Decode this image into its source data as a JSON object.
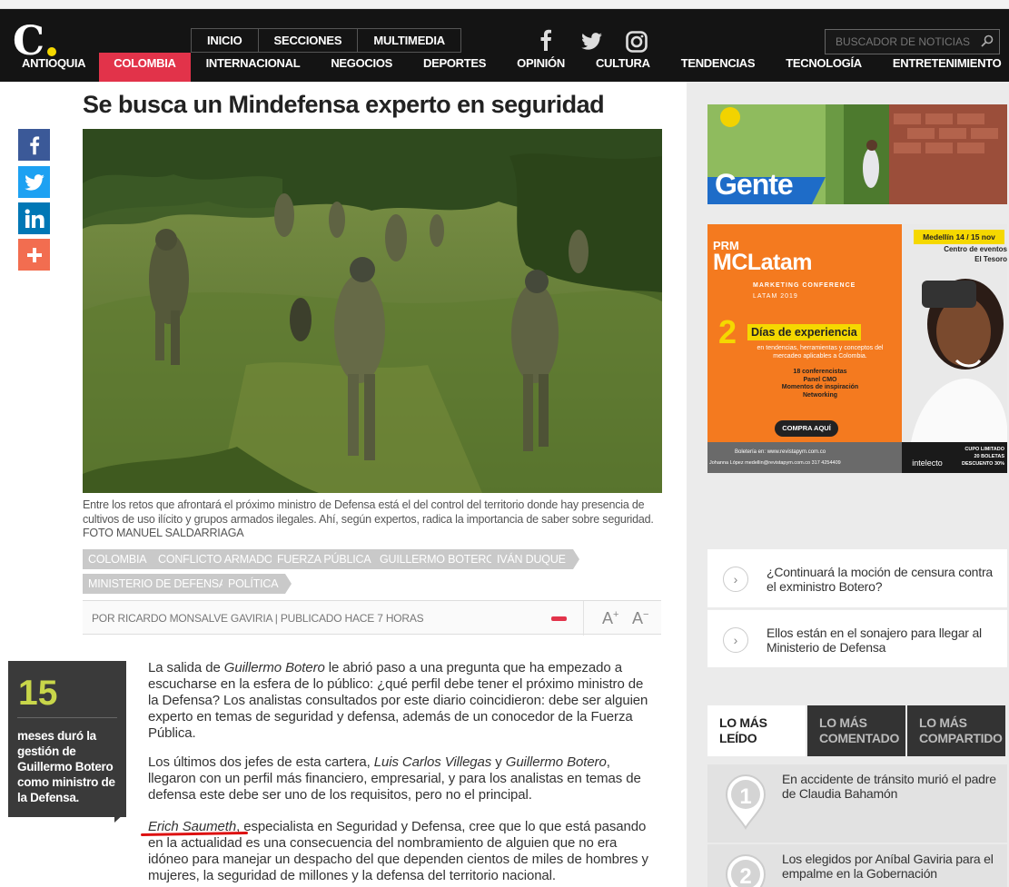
{
  "header": {
    "logo_letter": "C",
    "top_nav": [
      "INICIO",
      "SECCIONES",
      "MULTIMEDIA"
    ],
    "social_icons": [
      "facebook-icon",
      "twitter-icon",
      "instagram-icon"
    ],
    "search_placeholder": "BUSCADOR DE NOTICIAS",
    "sections": [
      "ANTIOQUIA",
      "COLOMBIA",
      "INTERNACIONAL",
      "NEGOCIOS",
      "DEPORTES",
      "OPINIÓN",
      "CULTURA",
      "TENDENCIAS",
      "TECNOLOGÍA",
      "ENTRETENIMIENTO"
    ],
    "active_section": "COLOMBIA",
    "accent_color": "#e2334a"
  },
  "share": {
    "icons": [
      "facebook-icon",
      "twitter-icon",
      "linkedin-icon",
      "plus-icon"
    ],
    "colors": [
      "#3b5998",
      "#1da1f2",
      "#0077b5",
      "#f26d50"
    ]
  },
  "article": {
    "title": "Se busca un Mindefensa experto en seguridad",
    "caption": "Entre los retos que afrontará el próximo ministro de Defensa está el del control del territorio donde hay presencia de cultivos de uso ilícito y grupos armados ilegales. Ahí, según expertos, radica la importancia de saber sobre seguridad. FOTO MANUEL SALDARRIAGA",
    "tags": [
      "COLOMBIA",
      "CONFLICTO ARMADO",
      "FUERZA PÚBLICA",
      "GUILLERMO BOTERO",
      "IVÁN DUQUE",
      "MINISTERIO DE DEFENSA",
      "POLÍTICA"
    ],
    "byline": "POR RICARDO MONSALVE GAVIRIA | PUBLICADO HACE 7 HORAS",
    "font_plus": "A",
    "font_minus": "A",
    "stat_number": "15",
    "stat_text": "meses duró la gestión de Guillermo Botero como ministro de la Defensa.",
    "p1": {
      "a": "La salida de ",
      "b": "Guillermo Botero",
      "c": " le abrió paso a una pregunta que ha empezado a escucharse en la esfera de lo público: ¿qué perfil debe tener el próximo ministro de la Defensa? Los analistas consultados por este diario coincidieron: debe ser alguien experto en temas de seguridad y defensa, además de un conocedor de la Fuerza Pública."
    },
    "p2": {
      "a": "Los últimos dos jefes de esta cartera, ",
      "b": "Luis Carlos Villegas",
      "c": " y ",
      "d": "Guillermo Botero",
      "e": ", llegaron con un perfil más financiero, empresarial, y para los analistas en temas de defensa este debe ser uno de los requisitos, pero no el principal."
    },
    "p3": {
      "a": "Erich Saumeth",
      "b": ", especialista en Seguridad y Defensa, cree que lo que está pasando en la actualidad es una consecuencia del nombramiento de alguien que no era idóneo para manejar un despacho del que dependen cientos de miles de hombres y mujeres, la seguridad de millones y la defensa del territorio nacional."
    }
  },
  "ads": {
    "gente": "Gente",
    "mclatam": {
      "brand": "PRM",
      "title": "MCLatam",
      "sub1": "MARKETING CONFERENCE",
      "sub2": "LATAM 2019",
      "date": "Medellín 14 / 15 nov",
      "venue1": "Centro de eventos",
      "venue2": "El Tesoro",
      "big_num": "2",
      "days": "Días de experiencia",
      "desc": "en tendencias, herramientas y conceptos del mercadeo aplicables a Colombia.",
      "l1": "18 conferencistas",
      "l2": "Panel CMO",
      "l3": "Momentos de inspiración",
      "l4": "Networking",
      "cta": "COMPRA AQUÍ",
      "foot1": "Boletería en: www.revistapym.com.co",
      "foot2": "Johanna López  medellin@revistapym.com.co  317 4254409",
      "partner": "intelecto",
      "promo1": "CUPO LIMITADO",
      "promo2": "20 BOLETAS",
      "promo3": "DESCUENTO 30%"
    }
  },
  "related": [
    "¿Continuará la moción de censura contra el exministro Botero?",
    "Ellos están en el sonajero para llegar al Ministerio de Defensa"
  ],
  "tabs": [
    "LO MÁS LEÍDO",
    "LO MÁS COMENTADO",
    "LO MÁS COMPARTIDO"
  ],
  "ranking": [
    {
      "num": "1",
      "text": "En accidente de tránsito murió el padre de Claudia Bahamón"
    },
    {
      "num": "2",
      "text": "Los elegidos por Aníbal Gaviria para el empalme en la Gobernación"
    }
  ]
}
